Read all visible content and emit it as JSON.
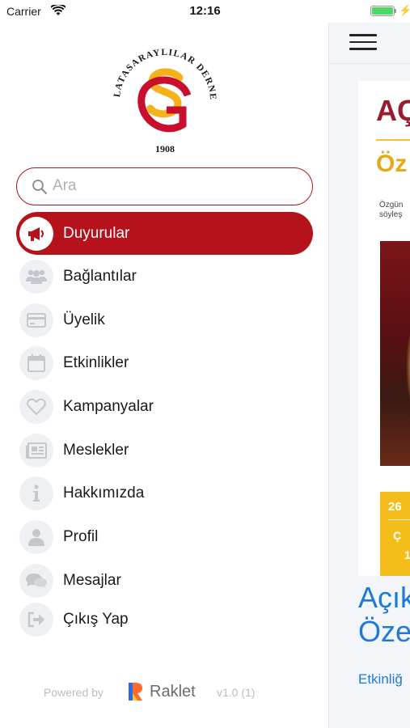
{
  "status_bar": {
    "carrier": "Carrier",
    "time": "12:16",
    "battery_level": 1.0
  },
  "drawer": {
    "logo": {
      "arc_text": "GALATASARAYLILAR DERNEĞİ",
      "year": "1908",
      "colors": {
        "red": "#c8102e",
        "yellow": "#f6b21a"
      }
    },
    "search": {
      "placeholder": "Ara",
      "value": ""
    },
    "menu_items": [
      {
        "label": "Duyurular",
        "icon": "megaphone-icon",
        "active": true
      },
      {
        "label": "Bağlantılar",
        "icon": "people-icon",
        "active": false
      },
      {
        "label": "Üyelik",
        "icon": "card-icon",
        "active": false
      },
      {
        "label": "Etkinlikler",
        "icon": "calendar-icon",
        "active": false
      },
      {
        "label": "Kampanyalar",
        "icon": "heart-icon",
        "active": false
      },
      {
        "label": "Meslekler",
        "icon": "newspaper-icon",
        "active": false
      },
      {
        "label": "Hakkımızda",
        "icon": "info-icon",
        "active": false
      },
      {
        "label": "Profil",
        "icon": "user-icon",
        "active": false
      },
      {
        "label": "Mesajlar",
        "icon": "chat-bubbles-icon",
        "active": false
      },
      {
        "label": "Çıkış Yap",
        "icon": "logout-icon",
        "active": false
      }
    ],
    "footer": {
      "powered_by": "Powered by",
      "brand": "Raklet",
      "version": "v1.0 (1)"
    }
  },
  "background": {
    "card_title": "AÇ",
    "card_subtitle": "Öz",
    "card_text_line1": "Özgün",
    "card_text_line2": "söyleş",
    "banner_date": "26",
    "banner_text1": "Ç",
    "banner_text2": "1",
    "heading_line1": "Açık",
    "heading_line2": "Öze",
    "link": "Etkinliğ"
  },
  "colors": {
    "accent": "#b5121b",
    "link": "#1e7ad9",
    "icon_bg": "#eef0f3",
    "icon_fg": "#c4c7cc"
  }
}
